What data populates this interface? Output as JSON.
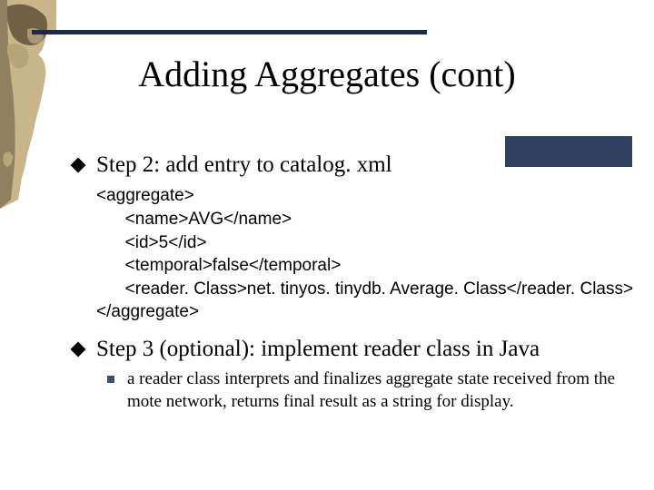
{
  "title": "Adding Aggregates (cont)",
  "step2": {
    "label": "Step 2: add entry to catalog. xml",
    "code": "<aggregate>\n      <name>AVG</name>\n      <id>5</id>\n      <temporal>false</temporal>\n      <reader. Class>net. tinyos. tinydb. Average. Class</reader. Class>\n</aggregate>"
  },
  "step3": {
    "label": "Step 3 (optional): implement reader class in Java",
    "sub": "a reader class interprets and finalizes aggregate state received from the mote network, returns final result as a string for display."
  }
}
